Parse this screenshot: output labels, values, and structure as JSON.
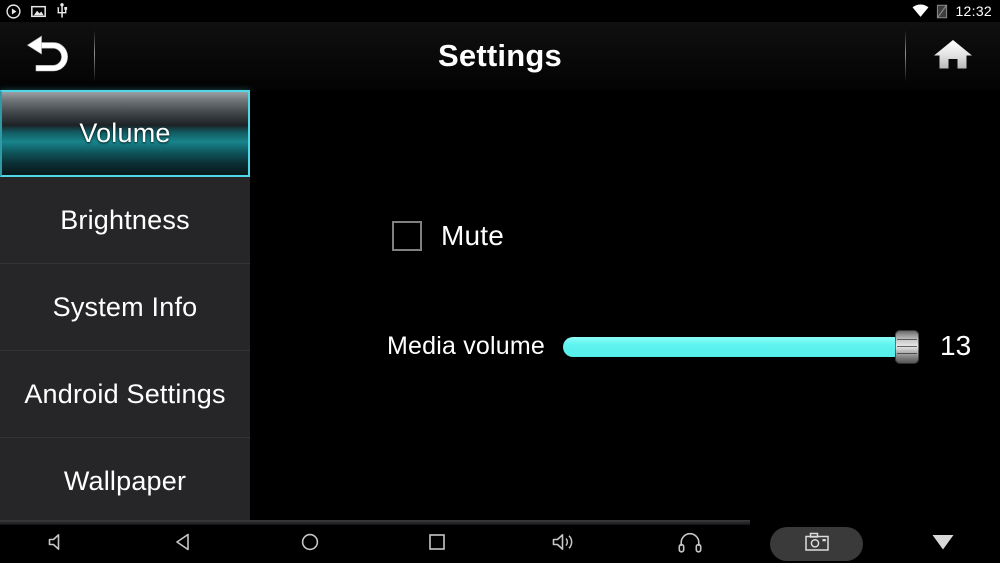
{
  "status_bar": {
    "icons_left": [
      "media-play-icon",
      "picture-icon",
      "usb-icon"
    ],
    "icons_right": [
      "wifi-icon",
      "sim-signal-icon"
    ],
    "clock": "12:32"
  },
  "title_bar": {
    "back_icon": "back-arrow-icon",
    "title": "Settings",
    "home_icon": "home-icon"
  },
  "sidebar": {
    "items": [
      {
        "label": "Volume",
        "selected": true
      },
      {
        "label": "Brightness",
        "selected": false
      },
      {
        "label": "System Info",
        "selected": false
      },
      {
        "label": "Android Settings",
        "selected": false
      },
      {
        "label": "Wallpaper",
        "selected": false
      }
    ]
  },
  "content": {
    "mute": {
      "label": "Mute",
      "checked": false
    },
    "media_volume": {
      "label": "Media volume",
      "value": "13",
      "percent": 96,
      "max": "15"
    }
  },
  "nav_bar": {
    "buttons": [
      {
        "name": "volume-down-icon"
      },
      {
        "name": "back-icon"
      },
      {
        "name": "home-icon"
      },
      {
        "name": "recents-icon"
      },
      {
        "name": "volume-up-icon"
      },
      {
        "name": "headphones-icon"
      },
      {
        "name": "screenshot-camera-icon"
      },
      {
        "name": "hide-navbar-icon"
      }
    ]
  },
  "colors": {
    "accent_cyan": "#5ef3ef",
    "selected_border": "#4fd8e6",
    "sidebar_bg": "#262628",
    "background": "#000000",
    "text": "#ffffff"
  }
}
